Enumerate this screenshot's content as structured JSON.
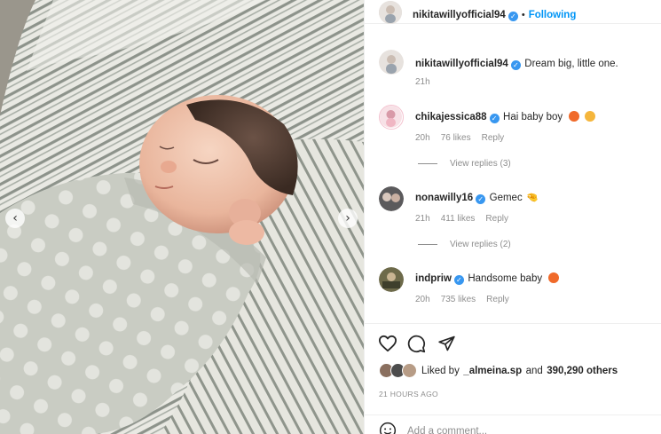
{
  "post": {
    "author": "nikitawillyofficial94",
    "following_label": "Following",
    "caption": "Dream big, little one.",
    "caption_time": "21h"
  },
  "comments": [
    {
      "user": "chikajessica88",
      "text": "Hai baby boy",
      "time": "20h",
      "likes": "76 likes",
      "reply": "Reply",
      "view_replies": "View replies (3)",
      "emoji": [
        "#f06a2a",
        "#f5b63c"
      ]
    },
    {
      "user": "nonawilly16",
      "text": "Gemec",
      "time": "21h",
      "likes": "411 likes",
      "reply": "Reply",
      "view_replies": "View replies (2)",
      "emoji_glyph": "🤏"
    },
    {
      "user": "indpriw",
      "text": "Handsome baby",
      "time": "20h",
      "likes": "735 likes",
      "reply": "Reply",
      "emoji": [
        "#f06a2a"
      ]
    }
  ],
  "actions": {
    "icons": [
      "heart-icon",
      "comment-icon",
      "share-icon"
    ],
    "liked_by_prefix": "Liked by",
    "liked_by_user": "_almeina.sp",
    "liked_by_and": "and",
    "liked_by_count": "390,290 others",
    "timestamp": "21 HOURS AGO",
    "comment_placeholder": "Add a comment..."
  },
  "colors": {
    "accent": "#0095f6",
    "verified": "#3897f0",
    "muted": "#8e8e8e"
  }
}
